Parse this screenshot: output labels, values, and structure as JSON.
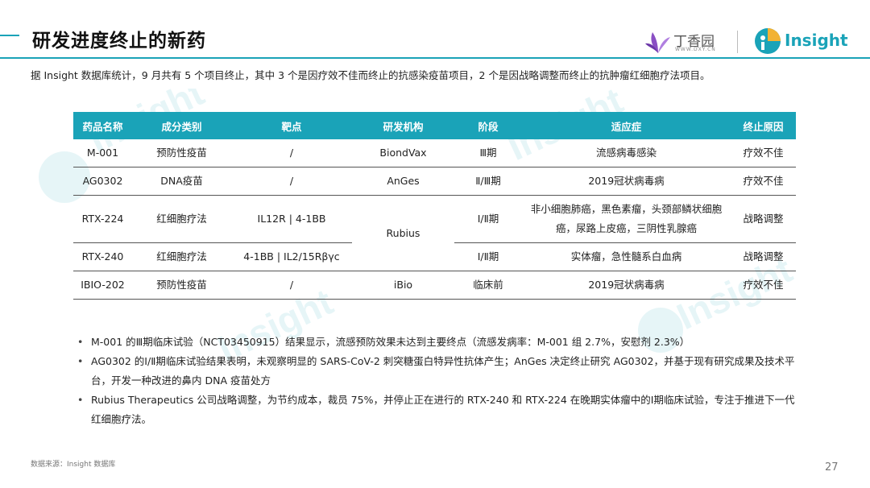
{
  "title": "研发进度终止的新药",
  "logos": {
    "dxy_name": "丁香园",
    "dxy_url": "WWW.DXY.CN",
    "insight_name": "Insight"
  },
  "intro": "据 Insight 数据库统计，9 月共有 5 个项目终止，其中 3 个是因疗效不佳而终止的抗感染疫苗项目，2 个是因战略调整而终止的抗肿瘤红细胞疗法项目。",
  "table": {
    "headers": [
      "药品名称",
      "成分类别",
      "靶点",
      "研发机构",
      "阶段",
      "适应症",
      "终止原因"
    ],
    "rows": [
      [
        "M-001",
        "预防性疫苗",
        "/",
        "BiondVax",
        "Ⅲ期",
        "流感病毒感染",
        "疗效不佳"
      ],
      [
        "AG0302",
        "DNA疫苗",
        "/",
        "AnGes",
        "Ⅱ/Ⅲ期",
        "2019冠状病毒病",
        "疗效不佳"
      ],
      [
        "RTX-224",
        "红细胞疗法",
        "IL12R | 4-1BB",
        "Rubius",
        "Ⅰ/Ⅱ期",
        "非小细胞肺癌，黑色素瘤，头颈部鳞状细胞癌，尿路上皮癌，三阴性乳腺癌",
        "战略调整"
      ],
      [
        "RTX-240",
        "红细胞疗法",
        "4-1BB | IL2/15Rβγc",
        "",
        "Ⅰ/Ⅱ期",
        "实体瘤，急性髓系白血病",
        "战略调整"
      ],
      [
        "IBIO-202",
        "预防性疫苗",
        "/",
        "iBio",
        "临床前",
        "2019冠状病毒病",
        "疗效不佳"
      ]
    ]
  },
  "bullets": [
    "M-001 的Ⅲ期临床试验（NCT03450915）结果显示，流感预防效果未达到主要终点（流感发病率：M-001 组 2.7%，安慰剂 2.3%）",
    "AG0302 的Ⅰ/Ⅱ期临床试验结果表明，未观察明显的 SARS-CoV-2 刺突糖蛋白特异性抗体产生；AnGes 决定终止研究 AG0302，并基于现有研究成果及技术平台，开发一种改进的鼻内 DNA 疫苗处方",
    "Rubius Therapeutics 公司战略调整，为节约成本，裁员 75%，并停止正在进行的 RTX-240 和 RTX-224 在晚期实体瘤中的Ⅰ期临床试验，专注于推进下一代红细胞疗法。"
  ],
  "source": "数据来源：Insight 数据库",
  "page_number": "27",
  "colors": {
    "accent": "#1aa3b8",
    "dxy_purple": "#8a4fc4"
  }
}
